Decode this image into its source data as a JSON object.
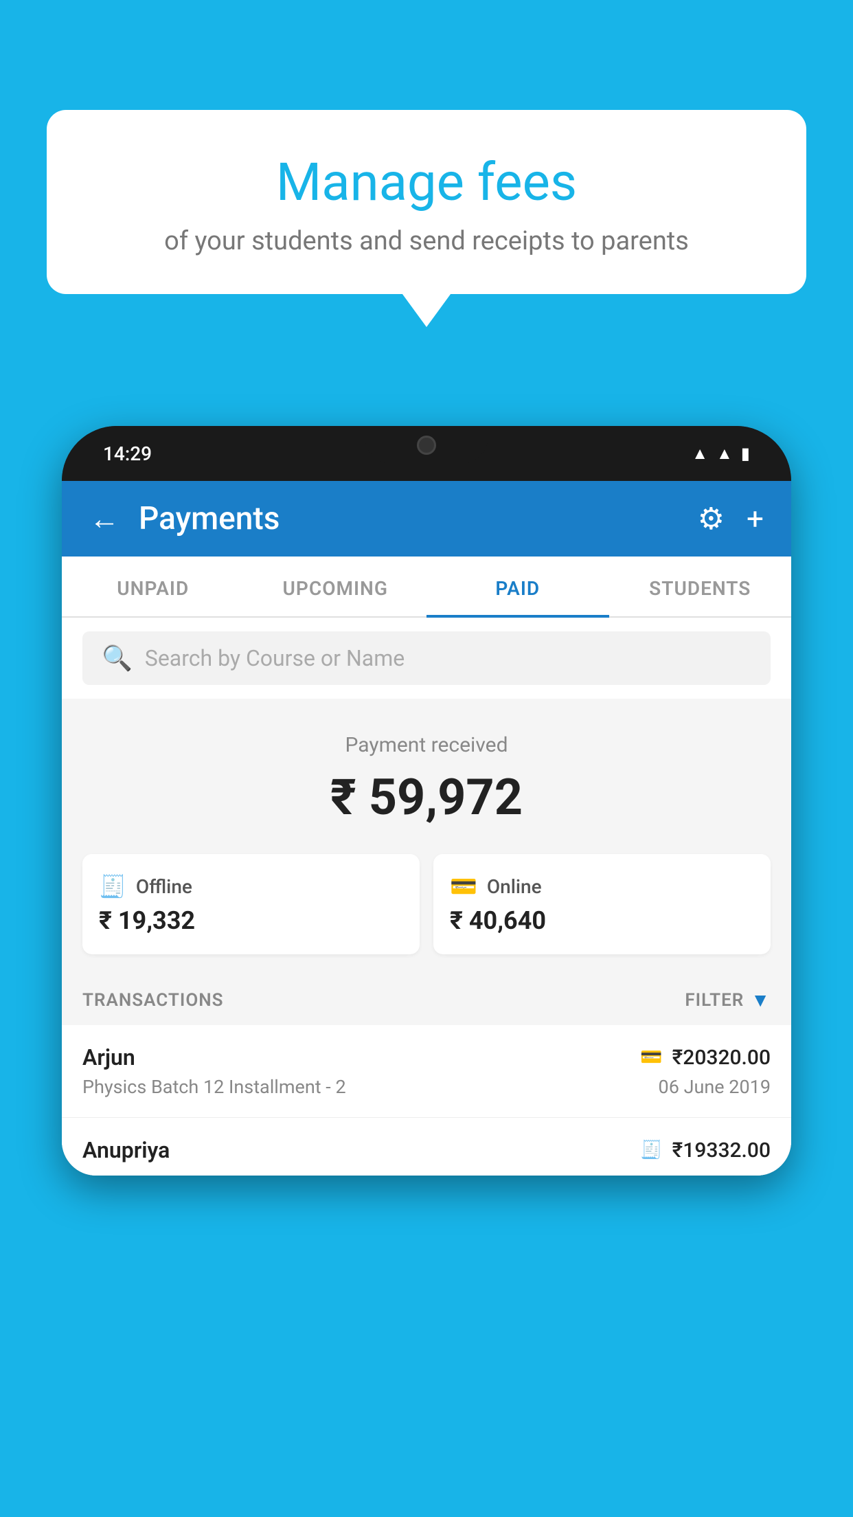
{
  "page": {
    "background_color": "#18b4e8"
  },
  "bubble": {
    "title": "Manage fees",
    "subtitle": "of your students and send receipts to parents"
  },
  "status_bar": {
    "time": "14:29",
    "icons": [
      "wifi",
      "signal",
      "battery"
    ]
  },
  "header": {
    "title": "Payments",
    "back_label": "←",
    "settings_label": "⚙",
    "add_label": "+"
  },
  "tabs": [
    {
      "id": "unpaid",
      "label": "UNPAID",
      "active": false
    },
    {
      "id": "upcoming",
      "label": "UPCOMING",
      "active": false
    },
    {
      "id": "paid",
      "label": "PAID",
      "active": true
    },
    {
      "id": "students",
      "label": "STUDENTS",
      "active": false
    }
  ],
  "search": {
    "placeholder": "Search by Course or Name"
  },
  "payment_summary": {
    "label": "Payment received",
    "amount": "₹ 59,972",
    "offline_label": "Offline",
    "offline_amount": "₹ 19,332",
    "online_label": "Online",
    "online_amount": "₹ 40,640"
  },
  "transactions": {
    "label": "TRANSACTIONS",
    "filter_label": "FILTER",
    "items": [
      {
        "name": "Arjun",
        "amount": "₹20320.00",
        "description": "Physics Batch 12 Installment - 2",
        "date": "06 June 2019",
        "payment_type": "online"
      },
      {
        "name": "Anupriya",
        "amount": "₹19332.00",
        "description": "",
        "date": "",
        "payment_type": "offline"
      }
    ]
  }
}
